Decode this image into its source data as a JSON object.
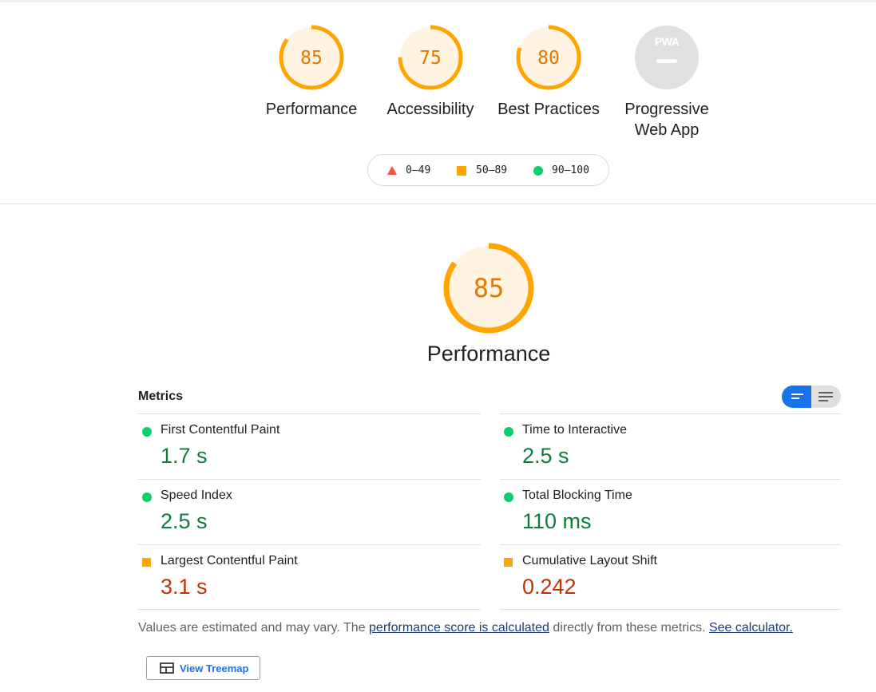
{
  "colors": {
    "average": "#ffa400",
    "average_bg": "#fff4e2",
    "average_text": "#e67700",
    "pass": "#0cce6b",
    "fail": "#ff4e42",
    "na": "#e0e0e0",
    "accent": "#1a73e8"
  },
  "categories": [
    {
      "score": 85,
      "label": "Performance"
    },
    {
      "score": 75,
      "label": "Accessibility"
    },
    {
      "score": 80,
      "label": "Best Practices"
    },
    {
      "badge": "PWA",
      "label_line1": "Progressive",
      "label_line2": "Web App"
    }
  ],
  "legend": [
    {
      "icon": "triangle-icon",
      "range": "0–49"
    },
    {
      "icon": "square-icon",
      "range": "50–89"
    },
    {
      "icon": "circle-icon",
      "range": "90–100"
    }
  ],
  "performance": {
    "score": 85,
    "title": "Performance"
  },
  "metrics": {
    "heading": "Metrics",
    "items": [
      {
        "label": "First Contentful Paint",
        "value": "1.7 s",
        "rating": "pass"
      },
      {
        "label": "Time to Interactive",
        "value": "2.5 s",
        "rating": "pass"
      },
      {
        "label": "Speed Index",
        "value": "2.5 s",
        "rating": "pass"
      },
      {
        "label": "Total Blocking Time",
        "value": "110 ms",
        "rating": "pass"
      },
      {
        "label": "Largest Contentful Paint",
        "value": "3.1 s",
        "rating": "average"
      },
      {
        "label": "Cumulative Layout Shift",
        "value": "0.242",
        "rating": "average"
      }
    ]
  },
  "note": {
    "prefix": "Values are estimated and may vary. The ",
    "link1": "performance score is calculated",
    "middle": " directly from these metrics. ",
    "link2": "See calculator."
  },
  "treemap": {
    "label": "View Treemap",
    "icon": "treemap-icon"
  }
}
